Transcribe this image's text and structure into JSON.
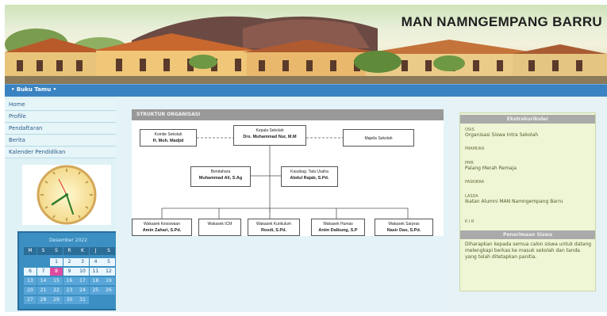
{
  "header": {
    "site_title": "MAN NAMNGEMPANG BARRU"
  },
  "nav": {
    "breadcrumb": "• Buku Tamu •"
  },
  "sidebar": {
    "menu": [
      "Home",
      "Profile",
      "Pendaftaran",
      "Berita",
      "Kalender Pendidikan"
    ],
    "clock": {
      "hour_hand": "8",
      "minute_hand": "25"
    },
    "calendar": {
      "title": "Desember 2022",
      "weekdays": [
        "M",
        "S",
        "S",
        "R",
        "K",
        "J",
        "S"
      ],
      "days": [
        "",
        "",
        "1",
        "2",
        "3",
        "4",
        "5",
        "6",
        "7",
        "8",
        "9",
        "10",
        "11",
        "12",
        "13",
        "14",
        "15",
        "16",
        "17",
        "18",
        "19",
        "20",
        "21",
        "22",
        "23",
        "24",
        "25",
        "26",
        "27",
        "28",
        "29",
        "30",
        "31",
        "",
        ""
      ],
      "highlight_day": "8"
    }
  },
  "org_chart": {
    "title": "STRUKTUR ORGANISASI",
    "boxes": [
      {
        "role": "Komite Sekolah",
        "name": "H. Moh. Madjid"
      },
      {
        "role": "Kepala Sekolah",
        "name": "Drs. Muhammad Nur, M.M"
      },
      {
        "role": "Majelis Sekolah",
        "name": ""
      },
      {
        "role": "Bendahara",
        "name": "Muhammad Ali, S.Ag"
      },
      {
        "role": "Kasubag. Tata Usaha",
        "name": "Abdul Rajab, S.Pd."
      },
      {
        "role": "Wakasek Kesiswaan",
        "name": "Amin Zahari, S.Pd."
      },
      {
        "role": "Wakasek ICM",
        "name": ""
      },
      {
        "role": "Wakasek Kurikulum",
        "name": "Rosdi, S.Pd."
      },
      {
        "role": "Wakasek Humas",
        "name": "Anim Dalbung, S.P"
      },
      {
        "role": "Wakasek Sarpras",
        "name": "Nasir Dao, S.Pd."
      }
    ]
  },
  "right_panel": {
    "section1_title": "Ekstrakurikuler",
    "items": [
      {
        "label": "OSIS",
        "text": "Organisasi Siswa Intra Sekolah"
      },
      {
        "label": "PRAMUKA",
        "text": ""
      },
      {
        "label": "PMR",
        "text": "Palang Merah Remaja"
      },
      {
        "label": "PASKIBRA",
        "text": ""
      },
      {
        "label": "LASDA",
        "text": "Ikatan Alumni MAN Namngempang Barru"
      },
      {
        "label": "K I R",
        "text": ""
      }
    ],
    "section2_title": "Penerimaan Siswa",
    "section2_text": "Diharapkan kepada semua calon siswa untuk datang melengkapi berkas ke masuk sekolah dan tanda yang telah ditetapkan panitia."
  },
  "colors": {
    "nav_blue": "#3a83c2",
    "sidebar_bg": "#dff2f6",
    "panel_header_gray": "#999999",
    "info_green": "#eef6d6"
  }
}
